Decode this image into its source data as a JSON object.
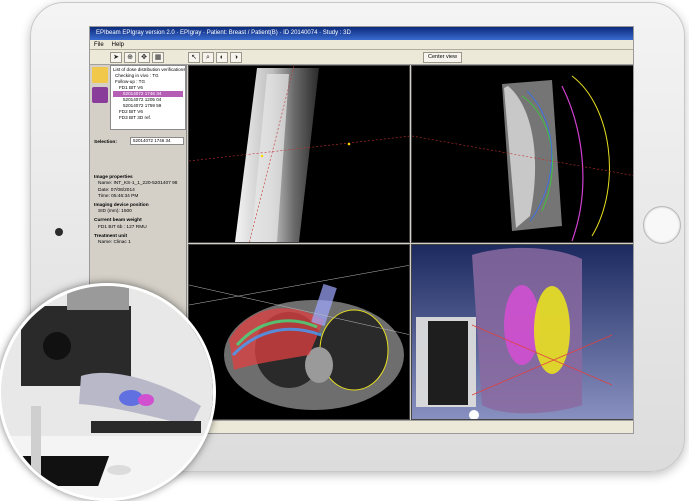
{
  "app": {
    "title": "EPIbeam EPIgray  version 2.0 · EPIgray ·  Patient: Breast / Patient(B)  · ID 20140074 · Study : 3D",
    "menu": [
      "File",
      "Help"
    ]
  },
  "toolbar": {
    "view_label": "Center view"
  },
  "sidebar": {
    "tree_title": "List of dose distribution verifications",
    "tree_items": [
      {
        "label": "Checking in vivo : TG",
        "level": 0
      },
      {
        "label": "Follow-up : TG",
        "level": 0
      },
      {
        "label": "FD1 BIT V6",
        "level": 1
      },
      {
        "label": "52014072 1746 34",
        "level": 2,
        "selected": true
      },
      {
        "label": "52014072 1205 04",
        "level": 2
      },
      {
        "label": "52014072 1759 59",
        "level": 2
      },
      {
        "label": "FD2 BIT V6",
        "level": 1
      },
      {
        "label": "FD3 BIT 3D ref.",
        "level": 1
      }
    ],
    "selection_label": "Selection:",
    "selection_value": "52014072 1746 34",
    "image_props_title": "Image properties",
    "image_props": [
      "Name: INT_KS-1_1_220-5201407 98",
      "Date: 07/08/2014",
      "Time: 05:46:34 PM"
    ],
    "device_pos_title": "Imaging device position",
    "device_pos": [
      "SID (mm): 1500"
    ],
    "beam_weight_title": "Current beam weight",
    "beam_weight": [
      "FD1 BIT 6b : 127 RMU"
    ],
    "treatment_unit_title": "Treatment unit",
    "treatment_unit": [
      "Name: Clinac 1"
    ]
  },
  "colors": {
    "title_blue": "#0b2a7a",
    "selection_purple": "#b45fb4",
    "dose_red": "#e04040",
    "contour_yellow": "#e8e020",
    "contour_magenta": "#d040d0"
  },
  "icons": [
    "person-icon",
    "epi-logo-icon",
    "pointer-icon",
    "zoom-icon",
    "pan-icon",
    "grid-icon",
    "window-icon"
  ]
}
